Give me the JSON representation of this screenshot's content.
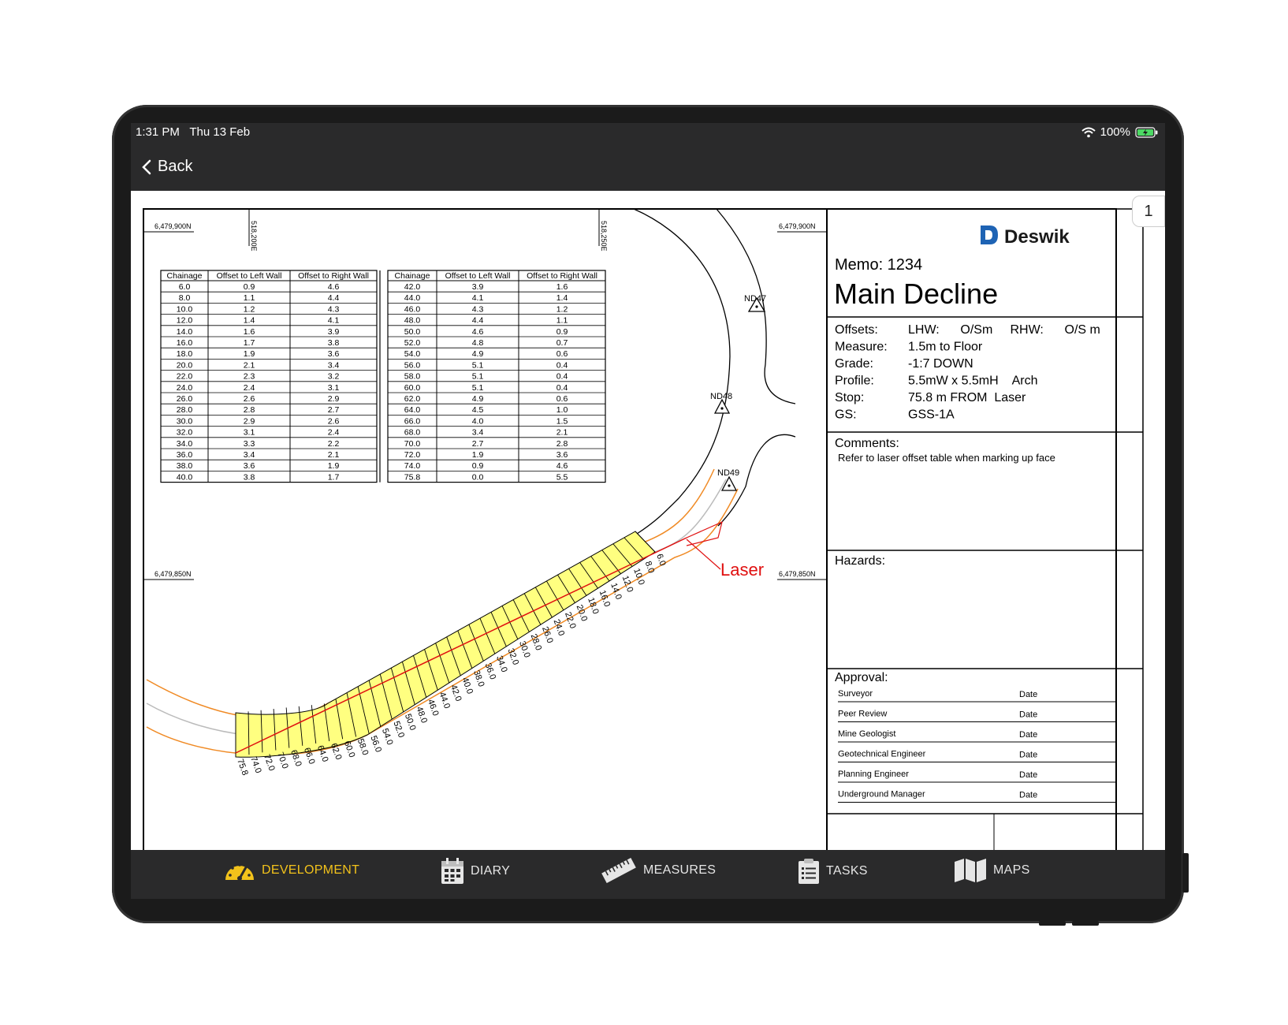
{
  "status": {
    "time": "1:31 PM",
    "date": "Thu 13 Feb",
    "battery": "100%"
  },
  "nav": {
    "back_label": "Back"
  },
  "page_number": "1",
  "grid": {
    "north_top_left": "6,479,900N",
    "north_top_right": "6,479,900N",
    "north_mid_left": "6,479,850N",
    "north_mid_right": "6,479,850N",
    "east_1": "518,200E",
    "east_2": "518,250E"
  },
  "offset_table": {
    "headers": [
      "Chainage",
      "Offset to Left Wall",
      "Offset to Right Wall"
    ],
    "left": [
      [
        "6.0",
        "0.9",
        "4.6"
      ],
      [
        "8.0",
        "1.1",
        "4.4"
      ],
      [
        "10.0",
        "1.2",
        "4.3"
      ],
      [
        "12.0",
        "1.4",
        "4.1"
      ],
      [
        "14.0",
        "1.6",
        "3.9"
      ],
      [
        "16.0",
        "1.7",
        "3.8"
      ],
      [
        "18.0",
        "1.9",
        "3.6"
      ],
      [
        "20.0",
        "2.1",
        "3.4"
      ],
      [
        "22.0",
        "2.3",
        "3.2"
      ],
      [
        "24.0",
        "2.4",
        "3.1"
      ],
      [
        "26.0",
        "2.6",
        "2.9"
      ],
      [
        "28.0",
        "2.8",
        "2.7"
      ],
      [
        "30.0",
        "2.9",
        "2.6"
      ],
      [
        "32.0",
        "3.1",
        "2.4"
      ],
      [
        "34.0",
        "3.3",
        "2.2"
      ],
      [
        "36.0",
        "3.4",
        "2.1"
      ],
      [
        "38.0",
        "3.6",
        "1.9"
      ],
      [
        "40.0",
        "3.8",
        "1.7"
      ]
    ],
    "right": [
      [
        "42.0",
        "3.9",
        "1.6"
      ],
      [
        "44.0",
        "4.1",
        "1.4"
      ],
      [
        "46.0",
        "4.3",
        "1.2"
      ],
      [
        "48.0",
        "4.4",
        "1.1"
      ],
      [
        "50.0",
        "4.6",
        "0.9"
      ],
      [
        "52.0",
        "4.8",
        "0.7"
      ],
      [
        "54.0",
        "4.9",
        "0.6"
      ],
      [
        "56.0",
        "5.1",
        "0.4"
      ],
      [
        "58.0",
        "5.1",
        "0.4"
      ],
      [
        "60.0",
        "5.1",
        "0.4"
      ],
      [
        "62.0",
        "4.9",
        "0.6"
      ],
      [
        "64.0",
        "4.5",
        "1.0"
      ],
      [
        "66.0",
        "4.0",
        "1.5"
      ],
      [
        "68.0",
        "3.4",
        "2.1"
      ],
      [
        "70.0",
        "2.7",
        "2.8"
      ],
      [
        "72.0",
        "1.9",
        "3.6"
      ],
      [
        "74.0",
        "0.9",
        "4.6"
      ],
      [
        "75.8",
        "0.0",
        "5.5"
      ]
    ]
  },
  "chainages": [
    "6.0",
    "8.0",
    "10.0",
    "12.0",
    "14.0",
    "16.0",
    "18.0",
    "20.0",
    "22.0",
    "24.0",
    "26.0",
    "28.0",
    "30.0",
    "32.0",
    "34.0",
    "36.0",
    "38.0",
    "40.0",
    "42.0",
    "44.0",
    "46.0",
    "48.0",
    "50.0",
    "52.0",
    "54.0",
    "56.0",
    "58.0",
    "60.0",
    "62.0",
    "64.0",
    "66.0",
    "68.0",
    "70.0",
    "72.0",
    "74.0",
    "75.8"
  ],
  "stations": [
    "ND47",
    "ND48",
    "ND49"
  ],
  "laser_label": "Laser",
  "panel": {
    "brand": "Deswik",
    "memo": "Memo: 1234",
    "title": "Main Decline",
    "fields": [
      {
        "label": "Offsets:",
        "value": "LHW:      O/Sm     RHW:      O/S m"
      },
      {
        "label": "Measure:",
        "value": "1.5m to Floor"
      },
      {
        "label": "Grade:",
        "value": "-1:7 DOWN"
      },
      {
        "label": "Profile:",
        "value": "5.5mW x 5.5mH    Arch"
      },
      {
        "label": "Stop:",
        "value": "75.8 m FROM  Laser"
      },
      {
        "label": "GS:",
        "value": "GSS-1A"
      }
    ],
    "comments_label": "Comments:",
    "comments_text": "Refer to laser offset table when marking up face",
    "hazards_label": "Hazards:",
    "approval_label": "Approval:",
    "approvals": [
      "Surveyor",
      "Peer Review",
      "Mine  Geologist",
      "Geotechnical Engineer",
      "Planning Engineer",
      "Underground Manager"
    ],
    "date_label": "Date"
  },
  "tabs": [
    {
      "label": "DEVELOPMENT",
      "icon": "gauge-icon",
      "active": true
    },
    {
      "label": "DIARY",
      "icon": "calendar-icon",
      "active": false
    },
    {
      "label": "MEASURES",
      "icon": "ruler-icon",
      "active": false
    },
    {
      "label": "TASKS",
      "icon": "clipboard-icon",
      "active": false
    },
    {
      "label": "MAPS",
      "icon": "map-icon",
      "active": false
    }
  ],
  "colors": {
    "accent": "#f2c21b",
    "fill": "#ffff80",
    "laser": "#e01010",
    "wall": "#f08a24"
  }
}
